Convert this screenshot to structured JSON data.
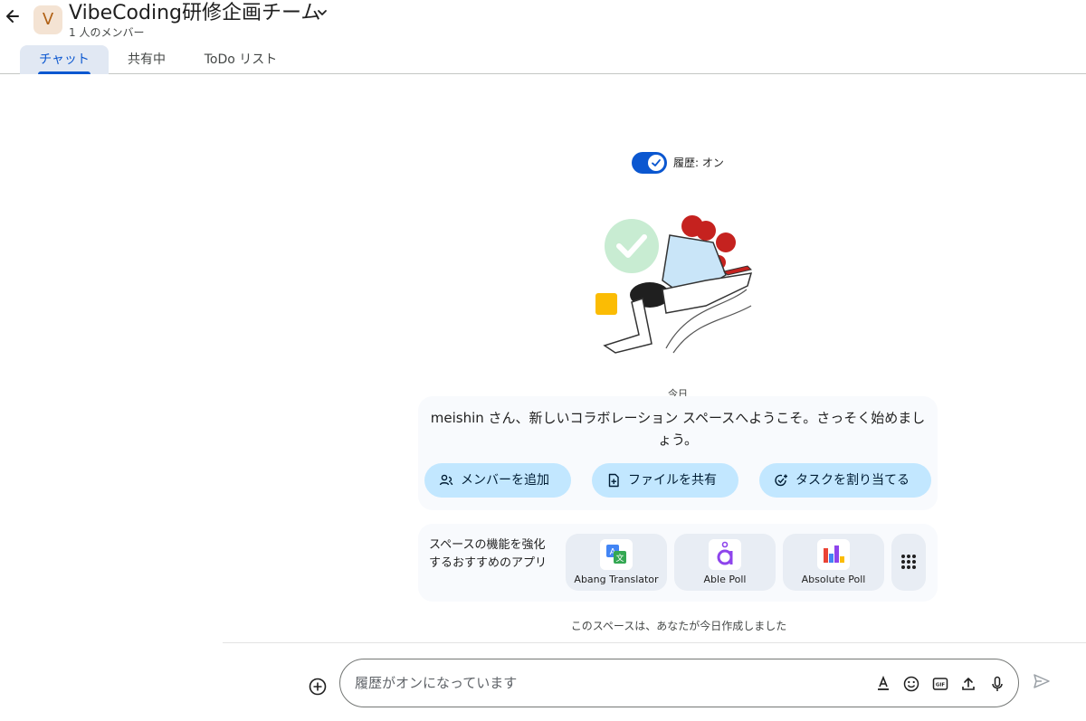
{
  "header": {
    "avatar_letter": "V",
    "space_name": "VibeCoding研修企画チーム",
    "members": "1 人のメンバー"
  },
  "tabs": [
    {
      "label": "チャット",
      "active": true
    },
    {
      "label": "共有中",
      "active": false
    },
    {
      "label": "ToDo リスト",
      "active": false
    }
  ],
  "history": {
    "label": "履歴: オン",
    "on": true
  },
  "date_chip": "今日",
  "welcome": {
    "line1": "meishin さん、新しいコラボレーション スペースへようこそ。さっそく始めまし",
    "line2": "ょう。"
  },
  "actions": [
    {
      "label": "メンバーを追加",
      "icon": "add-people-icon"
    },
    {
      "label": "ファイルを共有",
      "icon": "file-add-icon"
    },
    {
      "label": "タスクを割り当てる",
      "icon": "add-task-icon"
    }
  ],
  "apps": {
    "intro": "スペースの機能を強化するおすすめのアプリ",
    "items": [
      {
        "name": "Abang Translator",
        "icon": "translator-icon"
      },
      {
        "name": "Able Poll",
        "icon": "able-poll-icon"
      },
      {
        "name": "Absolute Poll",
        "icon": "bar-chart-icon"
      }
    ]
  },
  "created_note": "このスペースは、あなたが今日作成しました",
  "composer": {
    "placeholder": "履歴がオンになっています"
  },
  "colors": {
    "accent": "#0b57d0",
    "action_bg": "#c2e7ff",
    "card_bg": "#f8fafd",
    "avatar_bg": "#f4e3d3"
  }
}
